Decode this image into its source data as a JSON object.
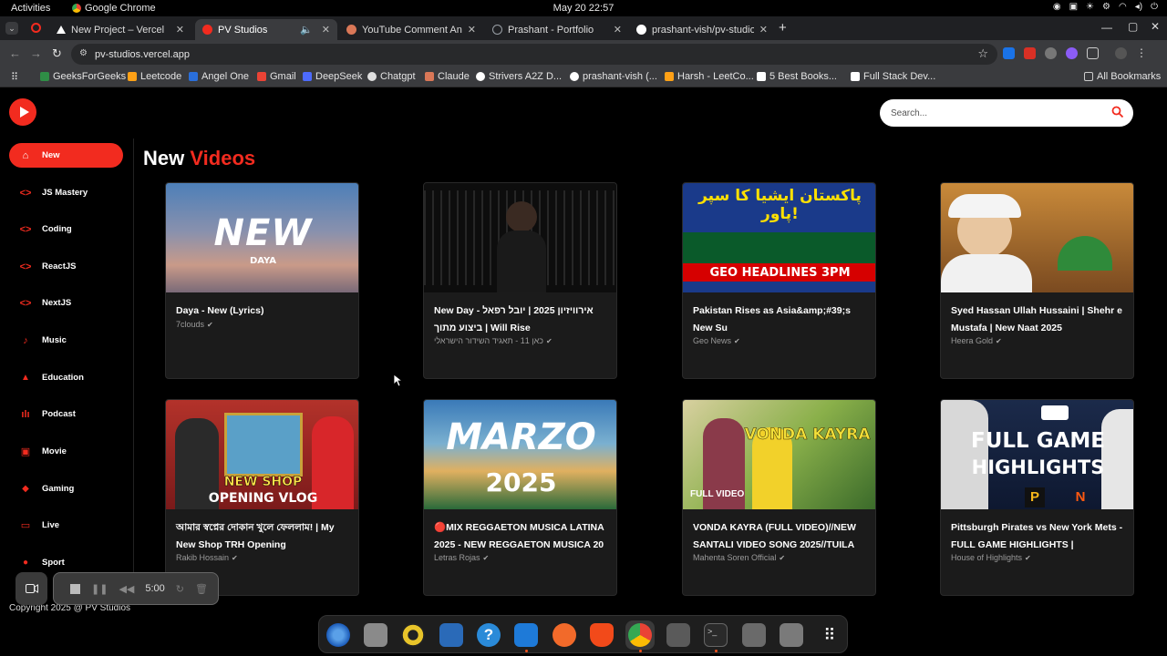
{
  "system": {
    "activities": "Activities",
    "app_name": "Google Chrome",
    "clock": "May 20  22:57"
  },
  "tabs": [
    {
      "title": "New Project – Vercel",
      "color": "#ffffff"
    },
    {
      "title": "PV Studios",
      "color": "#f22b1f"
    },
    {
      "title": "YouTube Comment Anal",
      "color": "#d97757"
    },
    {
      "title": "Prashant - Portfolio",
      "color": "#9aa0a6"
    },
    {
      "title": "prashant-vish/pv-studios",
      "color": "#ffffff"
    }
  ],
  "address": {
    "url": "pv-studios.vercel.app"
  },
  "bookmarks": [
    {
      "label": "GeeksForGeeks",
      "color": "#2f8d46"
    },
    {
      "label": "Leetcode",
      "color": "#ffa116"
    },
    {
      "label": "Angel One",
      "color": "#2a6fdb"
    },
    {
      "label": "Gmail",
      "color": "#ea4335"
    },
    {
      "label": "DeepSeek",
      "color": "#4d6bfe"
    },
    {
      "label": "Chatgpt",
      "color": "#e0e0e0"
    },
    {
      "label": "Claude",
      "color": "#d97757"
    },
    {
      "label": "Strivers A2Z D...",
      "color": "#ffffff"
    },
    {
      "label": "prashant-vish (...",
      "color": "#ffffff"
    },
    {
      "label": "Harsh - LeetCo...",
      "color": "#ffa116"
    },
    {
      "label": "5 Best Books...",
      "color": "#ffffff"
    },
    {
      "label": "Full Stack Dev...",
      "color": "#ffffff"
    }
  ],
  "all_bookmarks": "All Bookmarks",
  "search": {
    "placeholder": "Search..."
  },
  "sidebar": [
    {
      "label": "New",
      "icon": "home-icon",
      "glyph": "⌂"
    },
    {
      "label": "JS Mastery",
      "icon": "code-icon",
      "glyph": "<>"
    },
    {
      "label": "Coding",
      "icon": "code-icon",
      "glyph": "<>"
    },
    {
      "label": "ReactJS",
      "icon": "code-icon",
      "glyph": "<>"
    },
    {
      "label": "NextJS",
      "icon": "code-icon",
      "glyph": "<>"
    },
    {
      "label": "Music",
      "icon": "music-note-icon",
      "glyph": "♪"
    },
    {
      "label": "Education",
      "icon": "graduation-cap-icon",
      "glyph": "🎓"
    },
    {
      "label": "Podcast",
      "icon": "podcast-icon",
      "glyph": "ılı"
    },
    {
      "label": "Movie",
      "icon": "movie-icon",
      "glyph": "▣"
    },
    {
      "label": "Gaming",
      "icon": "gamepad-icon",
      "glyph": "🎮"
    },
    {
      "label": "Live",
      "icon": "live-icon",
      "glyph": "▭"
    },
    {
      "label": "Sport",
      "icon": "sport-icon",
      "glyph": "⚽"
    }
  ],
  "heading": {
    "part1": "New",
    "part2": "Videos"
  },
  "videos": [
    {
      "title": "Daya - New (Lyrics)",
      "channel": "7clouds",
      "thumb_text": "NEW",
      "thumb_sub": "DAYA"
    },
    {
      "title": "אירוויזיון 2025 | יובל רפאל - New Day Will Rise | ביצוע מתוך",
      "channel": "כאן 11 - תאגיד השידור הישראלי",
      "thumb_text": "",
      "thumb_sub": ""
    },
    {
      "title": "Pakistan Rises as Asia&amp;#39;s New Su",
      "channel": "Geo News",
      "thumb_text": "پاکستان ایشیا کا سپر پاور!",
      "thumb_sub": "GEO HEADLINES 3PM"
    },
    {
      "title": "Syed Hassan Ullah Hussaini | Shehr e Mustafa | New Naat 2025",
      "channel": "Heera Gold",
      "thumb_text": "",
      "thumb_sub": ""
    },
    {
      "title": "আমার স্বপ্নের দোকান খুলে ফেললাম! | My New Shop TRH Opening",
      "channel": "Rakib Hossain",
      "thumb_text": "NEW SHOP",
      "thumb_sub": "OPENING VLOG"
    },
    {
      "title": "🔴MIX REGGAETON MUSICA LATINA 2025 - NEW REGGAETON MUSICA 20",
      "channel": "Letras Rojas",
      "thumb_text": "MARZO",
      "thumb_sub": "2025"
    },
    {
      "title": "VONDA KAYRA (FULL VIDEO)//NEW SANTALI VIDEO SONG 2025//TUILA",
      "channel": "Mahenta Soren Official",
      "thumb_text": "VONDA KAYRA",
      "thumb_sub": "FULL VIDEO"
    },
    {
      "title": "Pittsburgh Pirates vs New York Mets - FULL GAME HIGHLIGHTS |",
      "channel": "House of Highlights",
      "thumb_text": "FULL GAME",
      "thumb_sub": "HIGHLIGHTS"
    }
  ],
  "recorder": {
    "time": "5:00"
  },
  "footer": {
    "text": "Copyright 2025 @ PV Studios"
  },
  "colors": {
    "accent": "#f22b1f",
    "card": "#1b1b1b"
  }
}
